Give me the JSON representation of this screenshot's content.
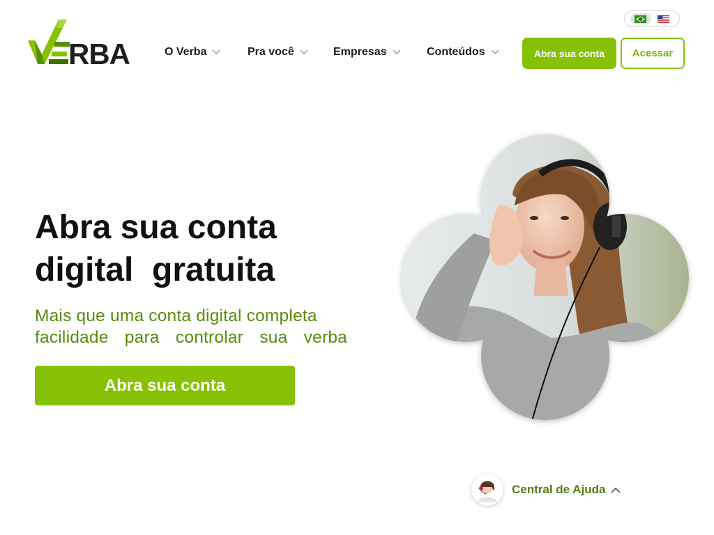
{
  "brand": {
    "name": "VERBA",
    "accent_color": "#86c104",
    "accent_dark": "#5a8a0a"
  },
  "language_switcher": {
    "options": [
      {
        "code": "pt-BR",
        "icon": "brazil-flag-icon",
        "active": true
      },
      {
        "code": "en-US",
        "icon": "usa-flag-icon",
        "active": false
      }
    ]
  },
  "nav": {
    "items": [
      {
        "label": "O Verba",
        "icon": "chevron-down-icon"
      },
      {
        "label": "Pra você",
        "icon": "chevron-down-icon"
      },
      {
        "label": "Empresas",
        "icon": "chevron-down-icon"
      },
      {
        "label": "Conteúdos",
        "icon": "chevron-down-icon"
      }
    ]
  },
  "header": {
    "open_account_label": "Abra sua conta",
    "login_label": "Acessar"
  },
  "hero": {
    "title": "Abra sua conta\ndigital  gratuita",
    "subtitle_line1": "Mais que uma conta digital completa",
    "subtitle_line2": "facilidade para controlar sua verba",
    "cta_label": "Abra sua conta",
    "image": "woman-with-headphones-clover-photo"
  },
  "help_widget": {
    "label": "Central de Ajuda",
    "icon": "chevron-up-icon",
    "avatar": "support-agent-avatar"
  }
}
